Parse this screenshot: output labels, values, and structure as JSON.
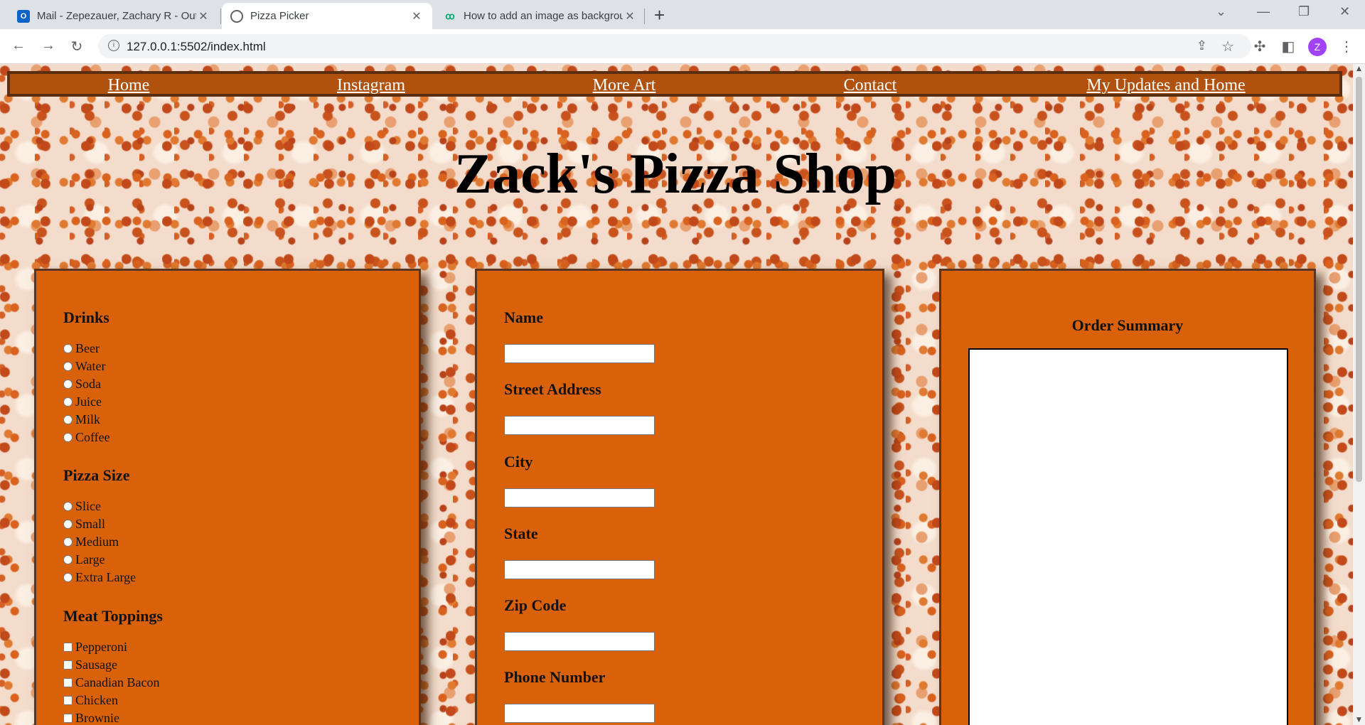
{
  "browser": {
    "tabs": [
      {
        "title": "Mail - Zepezauer, Zachary R - Outlook",
        "icon": "outlook-icon"
      },
      {
        "title": "Pizza Picker",
        "icon": "globe-icon"
      },
      {
        "title": "How to add an image as background",
        "icon": "w3schools-icon"
      }
    ],
    "url": "127.0.0.1:5502/index.html",
    "profile_initial": "Z",
    "profile_color": "#a142f4"
  },
  "nav": {
    "items": [
      "Home",
      "Instagram",
      "More Art",
      "Contact",
      "My Updates and Home"
    ]
  },
  "page": {
    "title": "Zack's Pizza Shop"
  },
  "left_panel": {
    "drinks": {
      "heading": "Drinks",
      "options": [
        "Beer",
        "Water",
        "Soda",
        "Juice",
        "Milk",
        "Coffee"
      ]
    },
    "size": {
      "heading": "Pizza Size",
      "options": [
        "Slice",
        "Small",
        "Medium",
        "Large",
        "Extra Large"
      ]
    },
    "meat": {
      "heading": "Meat Toppings",
      "options": [
        "Pepperoni",
        "Sausage",
        "Canadian Bacon",
        "Chicken",
        "Brownie"
      ]
    }
  },
  "middle_panel": {
    "fields": [
      "Name",
      "Street Address",
      "City",
      "State",
      "Zip Code",
      "Phone Number"
    ]
  },
  "right_panel": {
    "heading": "Order Summary",
    "summary_text": ""
  },
  "colors": {
    "panel": "#d9610a",
    "navbar": "#b0520d",
    "navbar_border": "#5a2e10"
  }
}
